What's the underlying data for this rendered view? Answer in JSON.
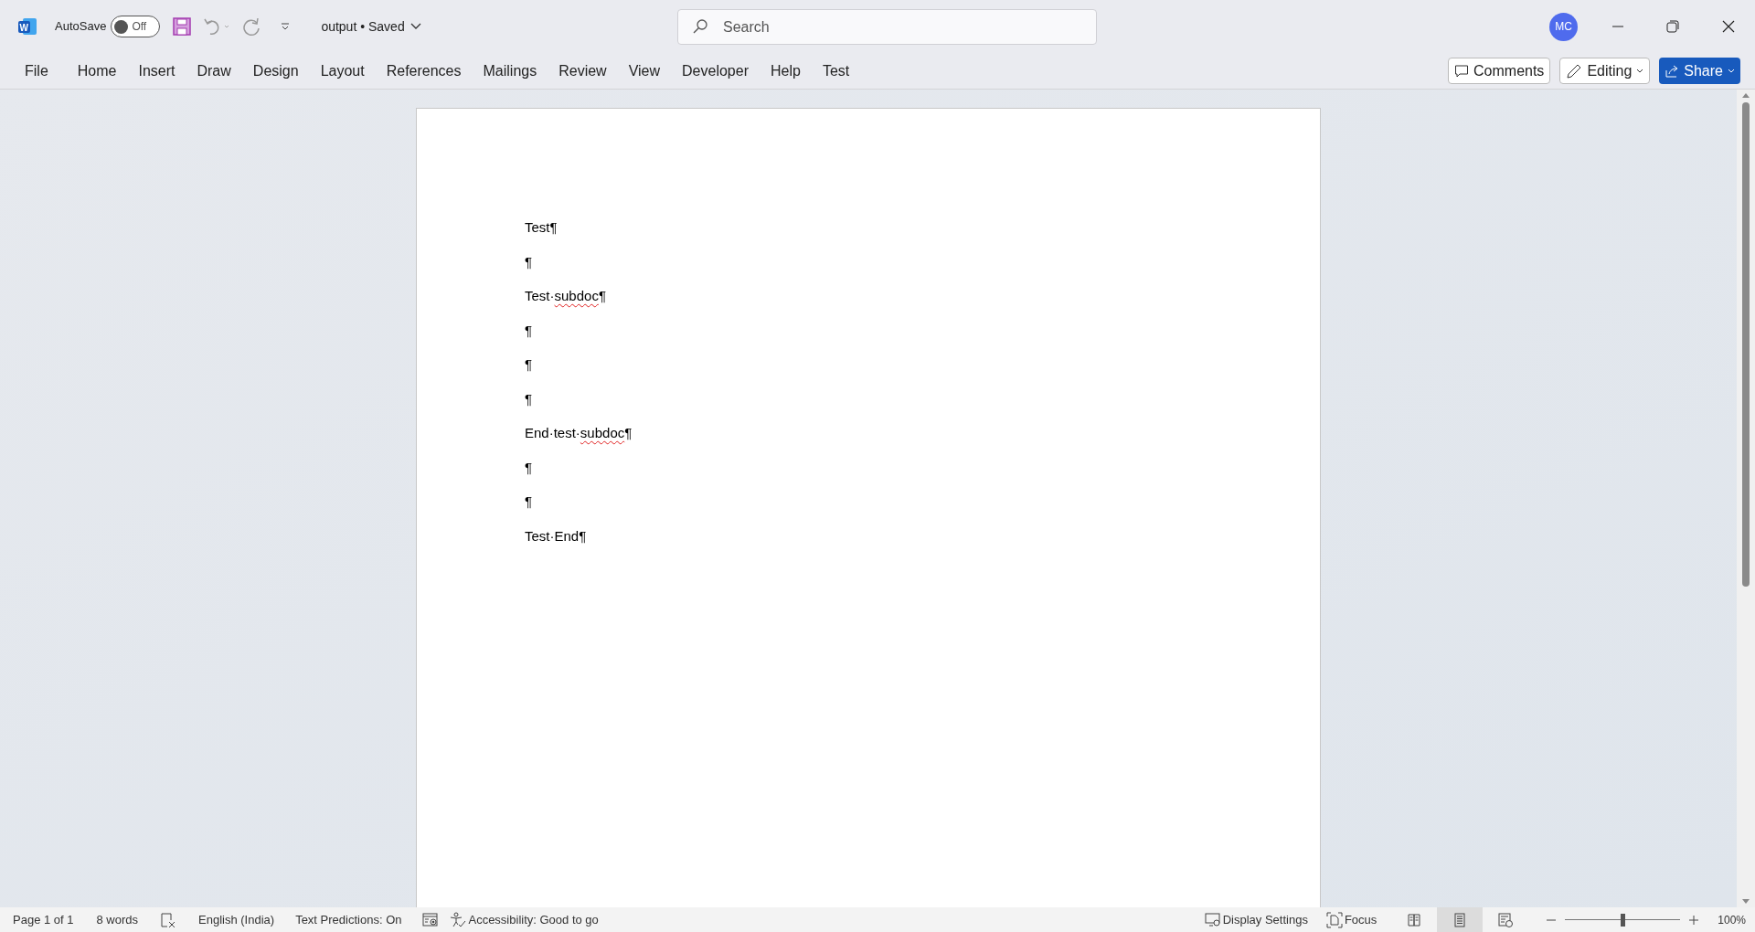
{
  "title_bar": {
    "app_logo_letter": "W",
    "autosave": {
      "label": "AutoSave",
      "on": false,
      "state_text": "Off"
    },
    "document_title": "output • Saved",
    "search": {
      "placeholder": "Search"
    },
    "account_initials": "MC"
  },
  "ribbon_tabs": [
    {
      "label": "File",
      "selected": false
    },
    {
      "label": "Home",
      "selected": false
    },
    {
      "label": "Insert",
      "selected": false
    },
    {
      "label": "Draw",
      "selected": false
    },
    {
      "label": "Design",
      "selected": false
    },
    {
      "label": "Layout",
      "selected": false
    },
    {
      "label": "References",
      "selected": false
    },
    {
      "label": "Mailings",
      "selected": false
    },
    {
      "label": "Review",
      "selected": false
    },
    {
      "label": "View",
      "selected": false
    },
    {
      "label": "Developer",
      "selected": false
    },
    {
      "label": "Help",
      "selected": false
    },
    {
      "label": "Test",
      "selected": false
    }
  ],
  "ribbon_buttons": {
    "comments": "Comments",
    "editing": "Editing",
    "share": "Share"
  },
  "document": {
    "paragraphs": [
      {
        "segments": [
          {
            "text": "Test¶",
            "misspelled": false
          }
        ]
      },
      {
        "segments": [
          {
            "text": "¶",
            "misspelled": false
          }
        ]
      },
      {
        "segments": [
          {
            "text": "Test·",
            "misspelled": false
          },
          {
            "text": "subdoc",
            "misspelled": true
          },
          {
            "text": "¶",
            "misspelled": false
          }
        ]
      },
      {
        "segments": [
          {
            "text": "¶",
            "misspelled": false
          }
        ]
      },
      {
        "segments": [
          {
            "text": "¶",
            "misspelled": false
          }
        ]
      },
      {
        "segments": [
          {
            "text": "¶",
            "misspelled": false
          }
        ]
      },
      {
        "segments": [
          {
            "text": "End·test·",
            "misspelled": false
          },
          {
            "text": "subdoc",
            "misspelled": true
          },
          {
            "text": "¶",
            "misspelled": false
          }
        ]
      },
      {
        "segments": [
          {
            "text": "¶",
            "misspelled": false
          }
        ]
      },
      {
        "segments": [
          {
            "text": "¶",
            "misspelled": false
          }
        ]
      },
      {
        "segments": [
          {
            "text": "Test·End¶",
            "misspelled": false
          }
        ]
      }
    ]
  },
  "status_bar": {
    "page": "Page 1 of 1",
    "words": "8 words",
    "language": "English (India)",
    "text_predictions": "Text Predictions: On",
    "accessibility": "Accessibility: Good to go",
    "display_settings": "Display Settings",
    "focus": "Focus",
    "views": [
      {
        "kind": "read",
        "selected": false
      },
      {
        "kind": "print",
        "selected": true
      },
      {
        "kind": "web",
        "selected": false
      }
    ],
    "zoom": {
      "level": 0.5,
      "reading": "100%"
    }
  }
}
